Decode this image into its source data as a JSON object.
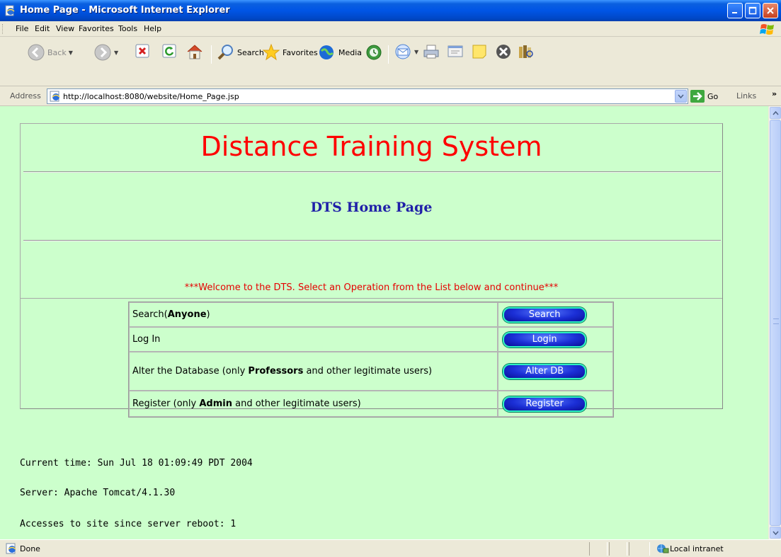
{
  "window": {
    "title": "Home Page - Microsoft Internet Explorer"
  },
  "menu": {
    "items": [
      "File",
      "Edit",
      "View",
      "Favorites",
      "Tools",
      "Help"
    ]
  },
  "toolbar": {
    "back_label": "Back",
    "search_label": "Search",
    "favorites_label": "Favorites",
    "media_label": "Media"
  },
  "address": {
    "label": "Address",
    "url": "http://localhost:8080/website/Home_Page.jsp",
    "go_label": "Go",
    "links_label": "Links"
  },
  "page": {
    "site_title": "Distance Training System",
    "heading": "DTS Home Page",
    "welcome": "***Welcome to the DTS. Select an Operation from the List below and continue***",
    "operations": [
      {
        "pre": "Search(",
        "bold": "Anyone",
        "post": ")",
        "button": "Search"
      },
      {
        "pre": "Log In",
        "bold": "",
        "post": "",
        "button": "Login"
      },
      {
        "pre": "Alter the Database (only ",
        "bold": "Professors",
        "post": " and other legitimate users)",
        "button": "Alter DB"
      },
      {
        "pre": "Register (only ",
        "bold": "Admin",
        "post": " and other legitimate users)",
        "button": "Register"
      }
    ],
    "current_time": "Current time: Sun Jul 18 01:09:49 PDT 2004",
    "server": "Server: Apache Tomcat/4.1.30",
    "accesses": "Accesses to site since server reboot: 1"
  },
  "status": {
    "text": "Done",
    "zone": "Local intranet"
  },
  "colors": {
    "page_bg": "#ccffcc",
    "title_red": "#ff0000",
    "heading_blue": "#1f1fa8",
    "welcome_red": "#e60000"
  }
}
